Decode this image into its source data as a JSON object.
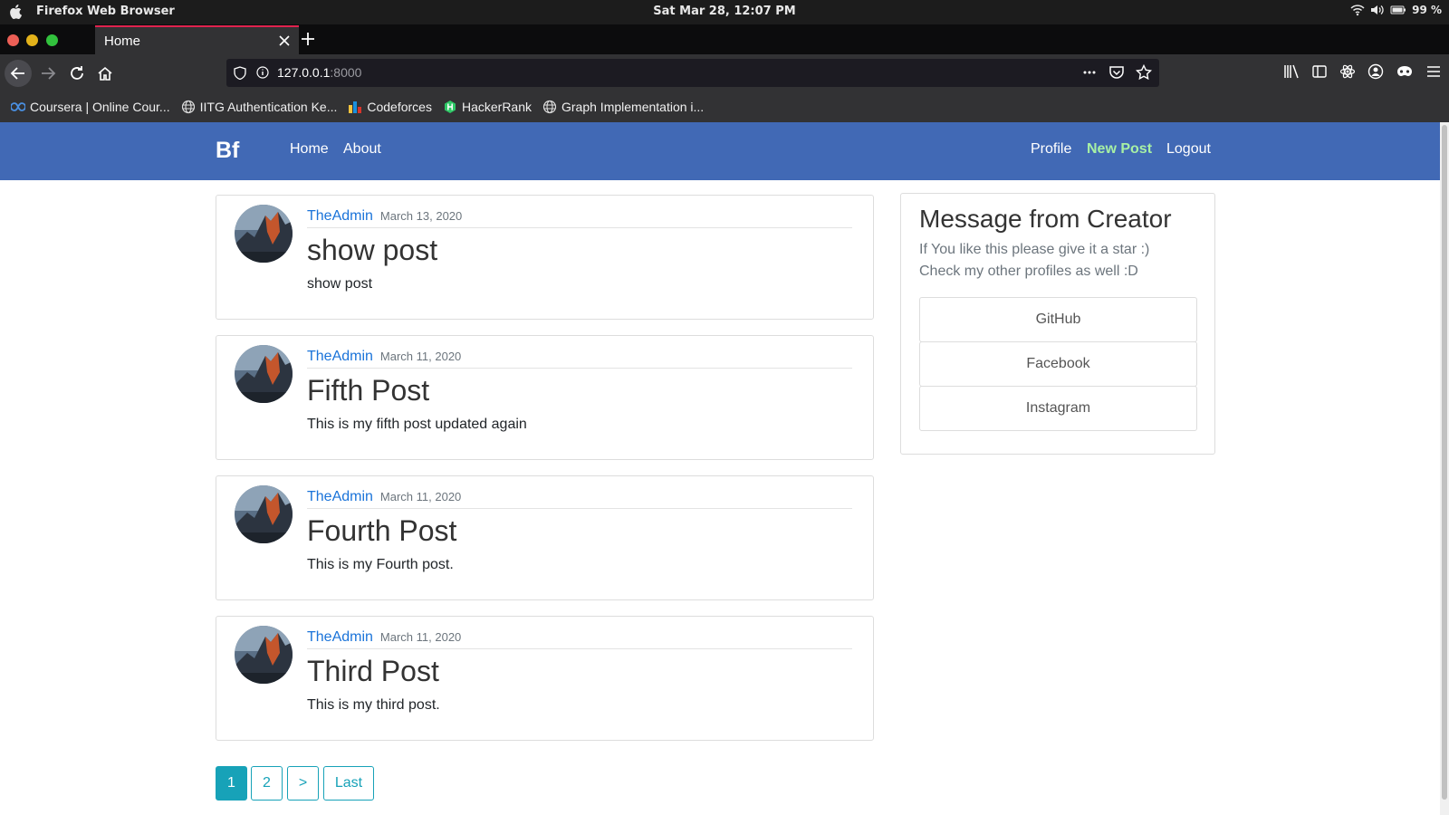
{
  "os": {
    "app_name": "Firefox Web Browser",
    "clock": "Sat Mar 28, 12:07 PM",
    "battery": "99 %"
  },
  "browser": {
    "tab_title": "Home",
    "url_host": "127.0.0.1",
    "url_port": ":8000",
    "bookmarks": [
      {
        "label": "Coursera | Online Cour...",
        "icon": "coursera-icon"
      },
      {
        "label": "IITG Authentication Ke...",
        "icon": "globe-icon"
      },
      {
        "label": "Codeforces",
        "icon": "codeforces-icon"
      },
      {
        "label": "HackerRank",
        "icon": "hackerrank-icon"
      },
      {
        "label": "Graph Implementation i...",
        "icon": "globe-icon"
      }
    ]
  },
  "site": {
    "brand": "Bf",
    "nav_left": [
      "Home",
      "About"
    ],
    "nav_right": [
      "Profile",
      "New Post",
      "Logout"
    ],
    "nav_highlight_color": "#a7f0a4",
    "navbar_color": "#4169b5"
  },
  "posts": [
    {
      "author": "TheAdmin",
      "date": "March 13, 2020",
      "title": "show post",
      "body": "show post"
    },
    {
      "author": "TheAdmin",
      "date": "March 11, 2020",
      "title": "Fifth Post",
      "body": "This is my fifth post updated again"
    },
    {
      "author": "TheAdmin",
      "date": "March 11, 2020",
      "title": "Fourth Post",
      "body": "This is my Fourth post."
    },
    {
      "author": "TheAdmin",
      "date": "March 11, 2020",
      "title": "Third Post",
      "body": "This is my third post."
    }
  ],
  "sidebar": {
    "title": "Message from Creator",
    "line1": "If You like this please give it a star :)",
    "line2": "Check my other profiles as well :D",
    "links": [
      "GitHub",
      "Facebook",
      "Instagram"
    ]
  },
  "pagination": {
    "items": [
      "1",
      "2",
      ">",
      "Last"
    ],
    "current": "1",
    "color": "#17a2b8"
  }
}
